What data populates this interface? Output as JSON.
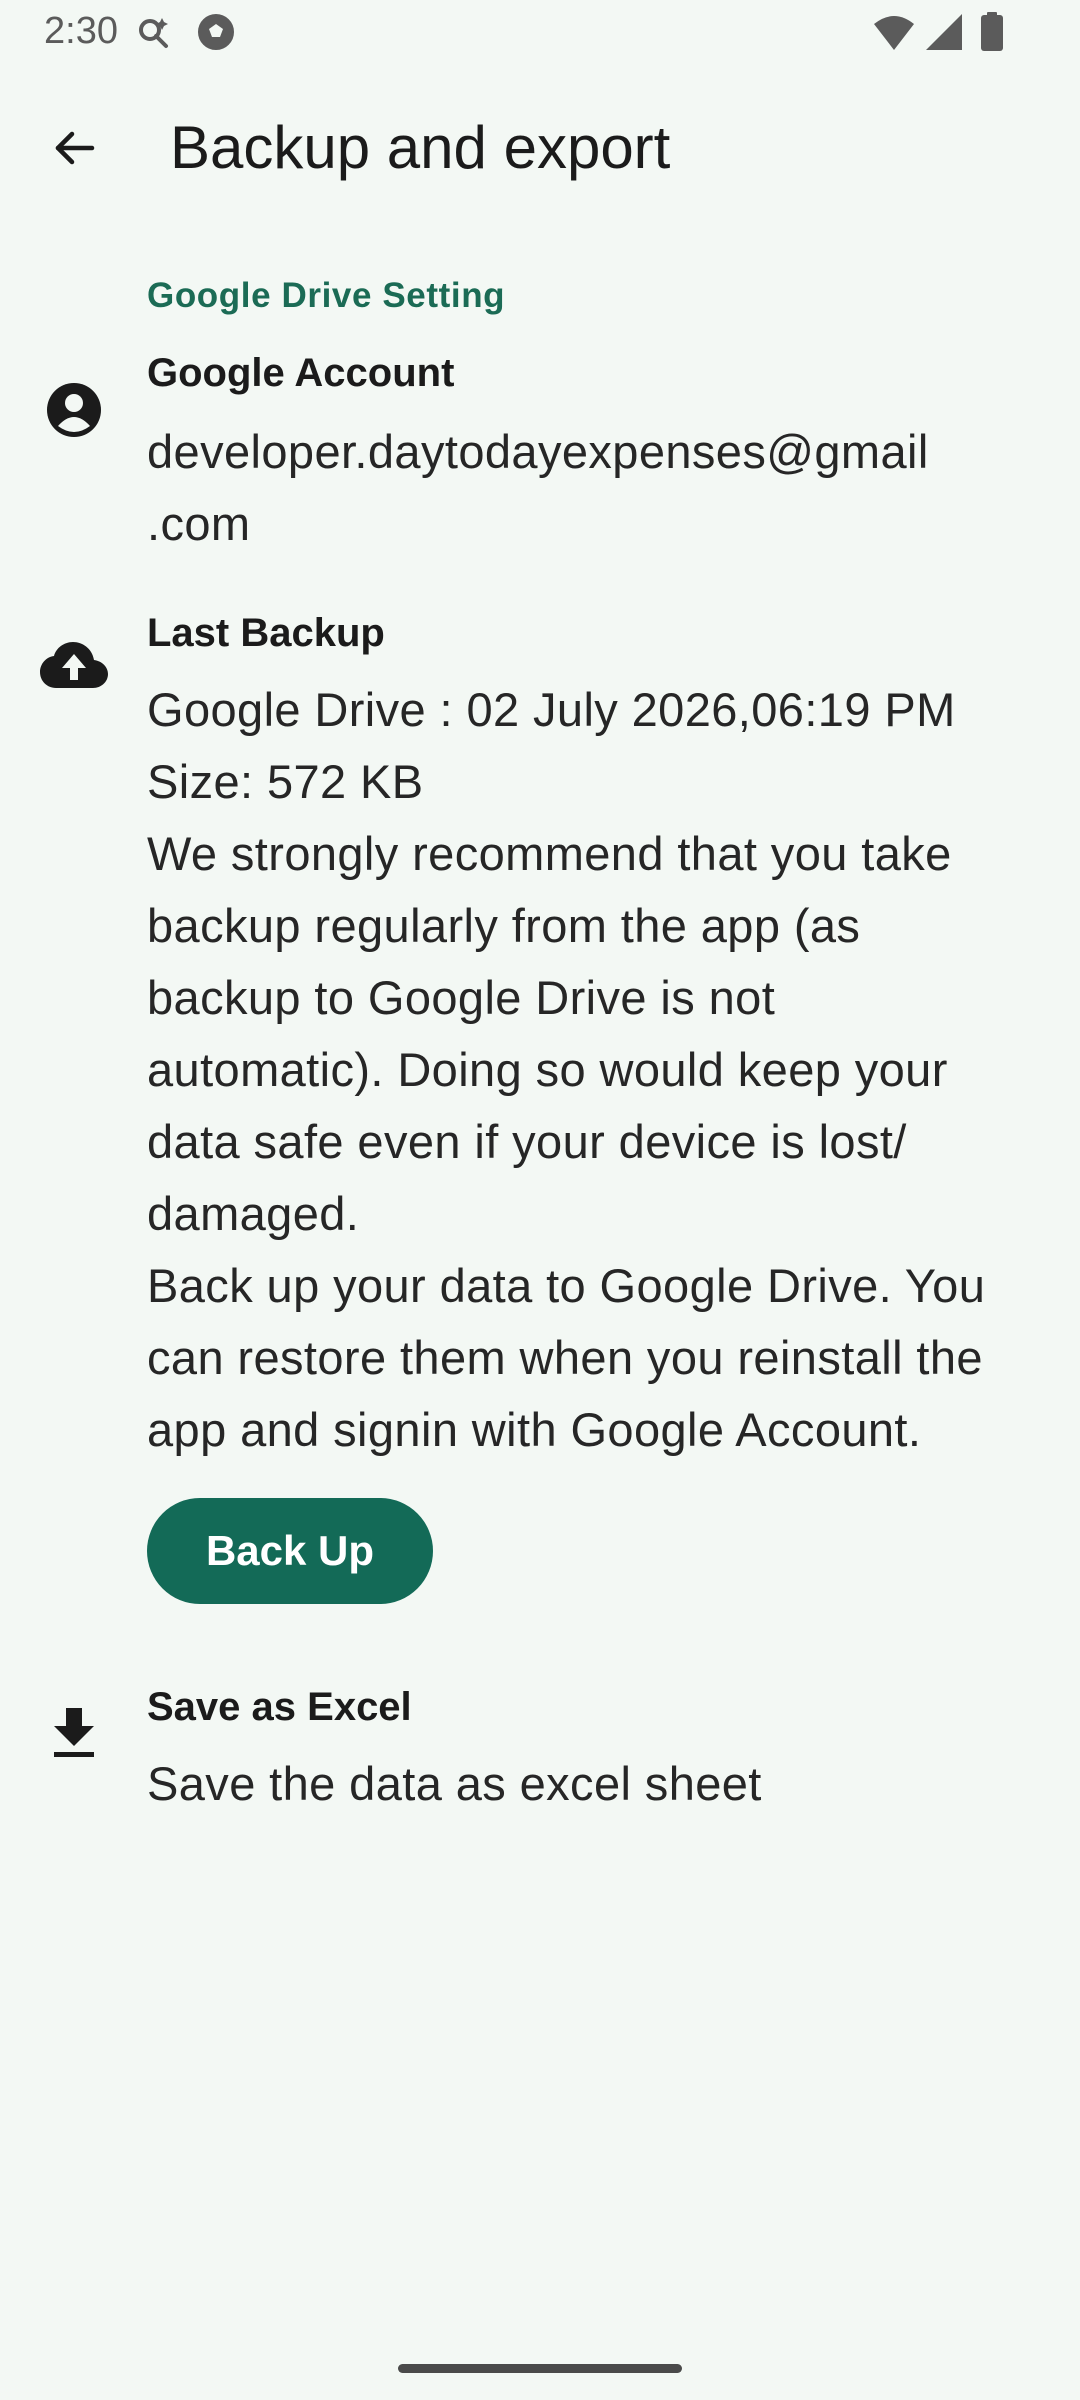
{
  "status_bar": {
    "time": "2:30",
    "icons": [
      "cast-search-icon",
      "football-icon",
      "wifi-icon",
      "signal-icon",
      "battery-icon"
    ]
  },
  "app_bar": {
    "back_icon": "arrow-back-icon",
    "title": "Backup and export"
  },
  "section": {
    "title": "Google Drive Setting"
  },
  "account": {
    "icon": "account-circle-icon",
    "title": "Google Account",
    "email_lines": [
      "developer.daytodayexpenses@gmail",
      ".com"
    ]
  },
  "last_backup": {
    "icon": "cloud-upload-icon",
    "title": "Last Backup",
    "lines": [
      "Google Drive : 02 July 2026,06:19 PM",
      "Size: 572 KB",
      "We strongly recommend that you take",
      "backup regularly from the app (as",
      "backup to Google Drive is not",
      "automatic). Doing so would keep your",
      "data safe even if your device is lost/",
      "damaged.",
      "Back up your data to Google Drive. You",
      "can restore them when you reinstall the",
      "app and signin with Google Account."
    ],
    "button_label": "Back Up"
  },
  "excel": {
    "icon": "download-icon",
    "title": "Save as Excel",
    "subtitle": "Save the data as excel sheet"
  },
  "colors": {
    "background": "#f3f8f4",
    "accent": "#136a57",
    "section_text": "#1b6b55"
  }
}
